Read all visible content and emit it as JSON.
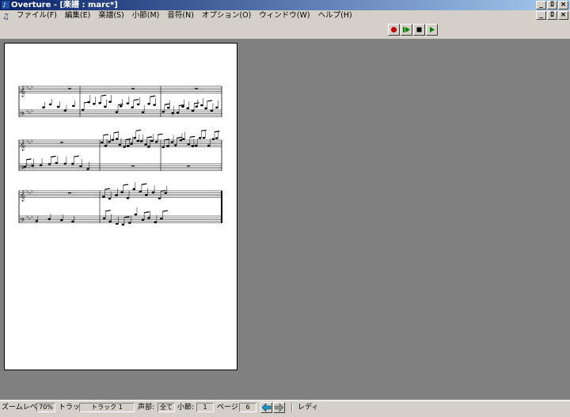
{
  "window": {
    "title": "Overture - [楽譜 : marc*]",
    "minimize": "_",
    "restore": "ﾛ",
    "close": "×"
  },
  "menu": {
    "items": [
      "ファイル(F)",
      "編集(E)",
      "楽譜(S)",
      "小節(M)",
      "音符(N)",
      "オプション(O)",
      "ウィンドウ(W)",
      "ヘルプ(H)"
    ]
  },
  "toolbar": {
    "record_icon": "record-icon",
    "play_from_start_icon": "play-from-start-icon",
    "stop_icon": "stop-icon",
    "play_icon": "play-icon",
    "colors": {
      "record": "#c00000",
      "play": "#008000",
      "stop": "#000000"
    }
  },
  "status": {
    "zoom_label": "ズームレベル:",
    "zoom_value": "70%",
    "track_label": "トラック:",
    "track_value": "トラック 1",
    "voice_label": "声部:",
    "voice_value": "全て",
    "measure_label": "小節:",
    "measure_value": "1",
    "page_label": "ページ:",
    "page_value": "6",
    "state": "レディ"
  },
  "score": {
    "systems": 3,
    "staves_per_system": [
      "treble",
      "bass"
    ],
    "key_signature": "E-flat major"
  }
}
